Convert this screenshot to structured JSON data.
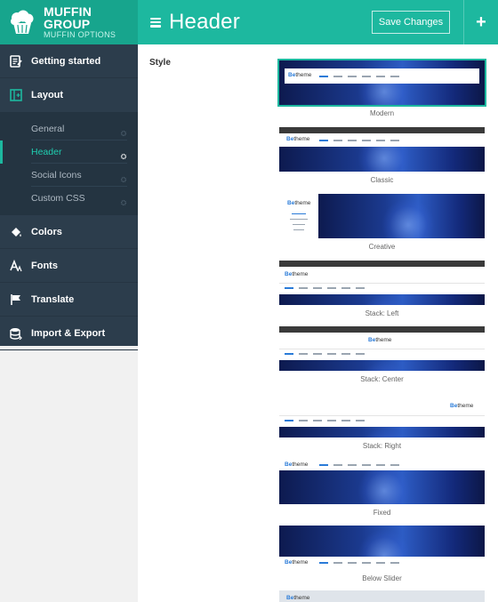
{
  "brand": {
    "name": "MUFFIN GROUP",
    "subtitle": "MUFFIN OPTIONS"
  },
  "header": {
    "title": "Header",
    "save_label": "Save Changes",
    "add_label": "+"
  },
  "sidebar": {
    "items": [
      {
        "label": "Getting started",
        "icon": "document-edit-icon"
      },
      {
        "label": "Layout",
        "icon": "layout-icon"
      },
      {
        "label": "Colors",
        "icon": "paint-bucket-icon"
      },
      {
        "label": "Fonts",
        "icon": "font-icon"
      },
      {
        "label": "Translate",
        "icon": "flag-icon"
      },
      {
        "label": "Import & Export",
        "icon": "database-icon"
      }
    ],
    "layout_sub": [
      {
        "label": "General",
        "active": false
      },
      {
        "label": "Header",
        "active": true
      },
      {
        "label": "Social Icons",
        "active": false
      },
      {
        "label": "Custom CSS",
        "active": false
      }
    ]
  },
  "main": {
    "section_label": "Style",
    "logo_text": "Be",
    "logo_suffix": "theme",
    "styles": [
      {
        "label": "Modern",
        "selected": true
      },
      {
        "label": "Classic",
        "selected": false
      },
      {
        "label": "Creative",
        "selected": false
      },
      {
        "label": "Stack: Left",
        "selected": false
      },
      {
        "label": "Stack: Center",
        "selected": false
      },
      {
        "label": "Stack: Right",
        "selected": false
      },
      {
        "label": "Fixed",
        "selected": false
      },
      {
        "label": "Below Slider",
        "selected": false
      }
    ]
  },
  "colors": {
    "accent": "#1db89f",
    "sidebar": "#2c3d4c",
    "sub_active": "#1fcfb1"
  }
}
